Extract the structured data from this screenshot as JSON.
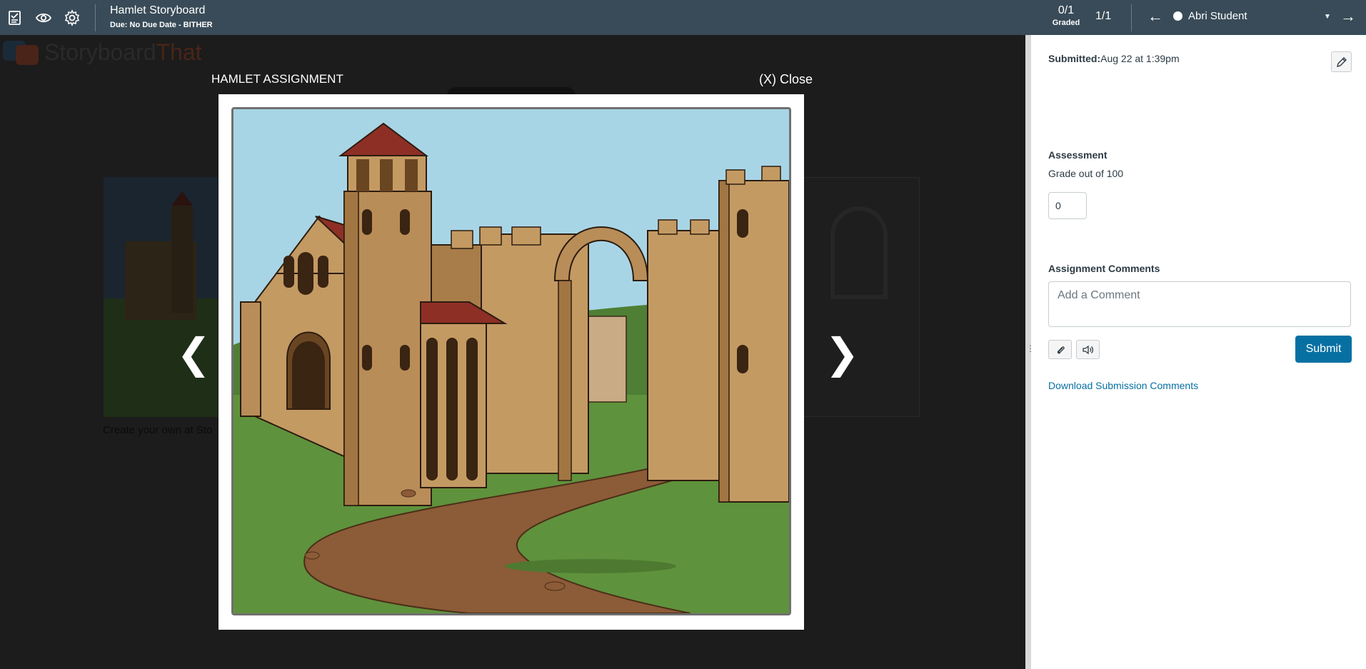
{
  "topbar": {
    "title": "Hamlet Storyboard",
    "subtitle": "Due: No Due Date - BITHER",
    "graded_count": "0/1",
    "graded_label": "Graded",
    "student_count": "1/1",
    "student_name": "Abri Student",
    "prev_arrow": "←",
    "next_arrow": "→",
    "caret": "▼"
  },
  "background": {
    "logo_story": "Storyboard",
    "logo_that": "That",
    "caption": "Create your own at Sto"
  },
  "modal": {
    "title": "HAMLET ASSIGNMENT",
    "close_label": "(X) Close",
    "prev_label": "❮",
    "next_label": "❯"
  },
  "sidebar": {
    "submitted_label": "Submitted:",
    "submitted_value": "Aug 22 at 1:39pm",
    "assessment_heading": "Assessment",
    "grade_label": "Grade out of 100",
    "grade_value": "0",
    "comments_heading": "Assignment Comments",
    "comment_placeholder": "Add a Comment",
    "submit_label": "Submit",
    "download_label": "Download Submission Comments"
  },
  "colors": {
    "topbar": "#394b58",
    "accent": "#0770a3",
    "sky": "#a8d5e6",
    "grass": "#5f923c",
    "stone": "#c49a63",
    "roof": "#8e2f26",
    "path": "#8c5b37"
  }
}
